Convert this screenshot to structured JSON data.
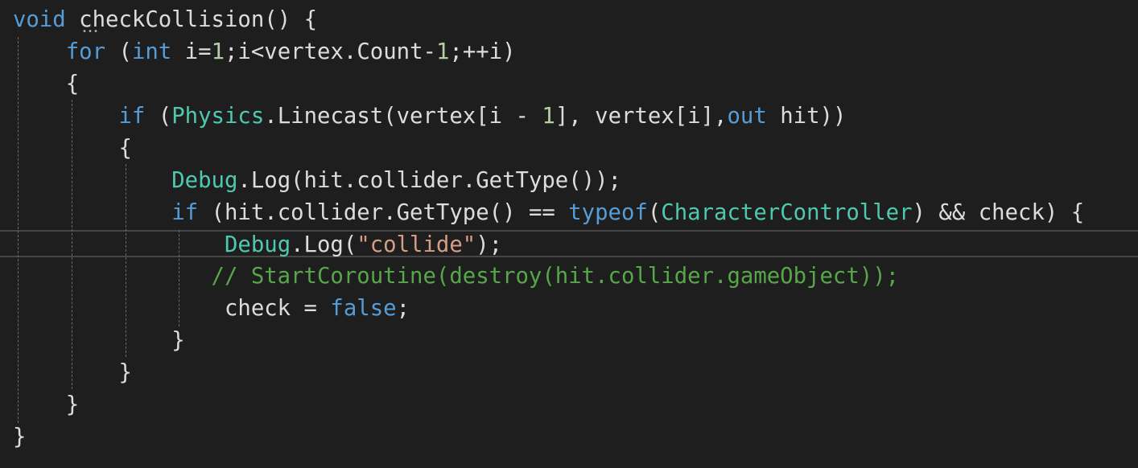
{
  "editor": {
    "lines": [
      [
        {
          "t": "void",
          "c": "kw"
        },
        {
          "t": " checkCollision() {",
          "c": "txt"
        }
      ],
      [
        {
          "t": "    ",
          "c": "txt"
        },
        {
          "t": "for",
          "c": "kw"
        },
        {
          "t": " (",
          "c": "txt"
        },
        {
          "t": "int",
          "c": "kw"
        },
        {
          "t": " i=",
          "c": "txt"
        },
        {
          "t": "1",
          "c": "num"
        },
        {
          "t": ";i<vertex.Count-",
          "c": "txt"
        },
        {
          "t": "1",
          "c": "num"
        },
        {
          "t": ";++i)",
          "c": "txt"
        }
      ],
      [
        {
          "t": "    {",
          "c": "txt"
        }
      ],
      [
        {
          "t": "        ",
          "c": "txt"
        },
        {
          "t": "if",
          "c": "kw"
        },
        {
          "t": " (",
          "c": "txt"
        },
        {
          "t": "Physics",
          "c": "type"
        },
        {
          "t": ".Linecast(vertex[i - ",
          "c": "txt"
        },
        {
          "t": "1",
          "c": "num"
        },
        {
          "t": "], vertex[i],",
          "c": "txt"
        },
        {
          "t": "out",
          "c": "kw"
        },
        {
          "t": " hit))",
          "c": "txt"
        }
      ],
      [
        {
          "t": "        {",
          "c": "txt"
        }
      ],
      [
        {
          "t": "            ",
          "c": "txt"
        },
        {
          "t": "Debug",
          "c": "type"
        },
        {
          "t": ".Log(hit.collider.GetType());",
          "c": "txt"
        }
      ],
      [
        {
          "t": "            ",
          "c": "txt"
        },
        {
          "t": "if",
          "c": "kw"
        },
        {
          "t": " (hit.collider.GetType() == ",
          "c": "txt"
        },
        {
          "t": "typeof",
          "c": "kw"
        },
        {
          "t": "(",
          "c": "txt"
        },
        {
          "t": "CharacterController",
          "c": "type"
        },
        {
          "t": ") && check) {",
          "c": "txt"
        }
      ],
      [
        {
          "t": "                ",
          "c": "txt"
        },
        {
          "t": "Debug",
          "c": "type"
        },
        {
          "t": ".Log(",
          "c": "txt"
        },
        {
          "t": "\"collide\"",
          "c": "str"
        },
        {
          "t": ");",
          "c": "txt"
        }
      ],
      [
        {
          "t": "               ",
          "c": "txt"
        },
        {
          "t": "// StartCoroutine(destroy(hit.collider.gameObject));",
          "c": "cmt"
        }
      ],
      [
        {
          "t": "                check = ",
          "c": "txt"
        },
        {
          "t": "false",
          "c": "kw"
        },
        {
          "t": ";",
          "c": "txt"
        }
      ],
      [
        {
          "t": "            }",
          "c": "txt"
        }
      ],
      [
        {
          "t": "        }",
          "c": "txt"
        }
      ],
      [
        {
          "t": "    }",
          "c": "txt"
        }
      ],
      [
        {
          "t": "}",
          "c": "txt"
        }
      ]
    ]
  },
  "colors": {
    "background": "#1e1e1e",
    "keyword": "#569cd6",
    "type": "#4ec9b0",
    "number": "#b5cea8",
    "string": "#d69d85",
    "comment": "#57a64a",
    "text": "#dcdcdc"
  }
}
